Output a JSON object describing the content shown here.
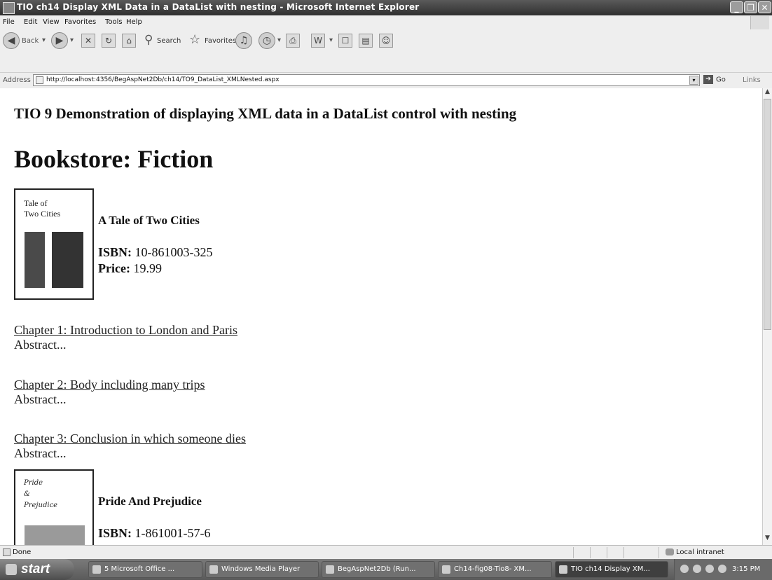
{
  "window": {
    "title": "TIO ch14 Display XML Data in a DataList with nesting - Microsoft Internet Explorer",
    "minimize": "_",
    "maximize": "❐",
    "close": "✕"
  },
  "menu": [
    "File",
    "Edit",
    "View",
    "Favorites",
    "Tools",
    "Help"
  ],
  "toolbar": {
    "back": "Back",
    "search": "Search",
    "favorites": "Favorites"
  },
  "address": {
    "label": "Address",
    "url": "http://localhost:4356/BegAspNet2Db/ch14/TO9_DataList_XMLNested.aspx",
    "go": "Go",
    "links": "Links"
  },
  "page": {
    "heading": "TIO 9 Demonstration of displaying XML data in a DataList control with nesting",
    "store_title": "Bookstore: Fiction",
    "books": [
      {
        "cover_line1": "Tale of",
        "cover_line2": "Two Cities",
        "title": "A Tale of Two Cities",
        "isbn_label": "ISBN:",
        "isbn": "10-861003-325",
        "price_label": "Price:",
        "price": "19.99",
        "chapters": [
          {
            "title": "Chapter 1: Introduction to London and Paris",
            "abstract": "Abstract..."
          },
          {
            "title": "Chapter 2: Body including many trips",
            "abstract": "Abstract..."
          },
          {
            "title": "Chapter 3: Conclusion in which someone dies",
            "abstract": "Abstract..."
          }
        ]
      },
      {
        "cover_line1": "Pride",
        "cover_line2": "&",
        "cover_line3": "Prejudice",
        "title": "Pride And Prejudice",
        "isbn_label": "ISBN:",
        "isbn": "1-861001-57-6"
      }
    ]
  },
  "status": {
    "text": "Done",
    "zone": "Local intranet"
  },
  "taskbar": {
    "start": "start",
    "tasks": [
      "5 Microsoft Office ...",
      "Windows Media Player",
      "BegAspNet2Db (Run...",
      "Ch14-fig08-Tio8- XM...",
      "TIO ch14 Display XM..."
    ],
    "time": "3:15 PM"
  },
  "icons": {
    "app": "ie-icon",
    "page": "page-icon",
    "zone": "intranet-icon"
  }
}
